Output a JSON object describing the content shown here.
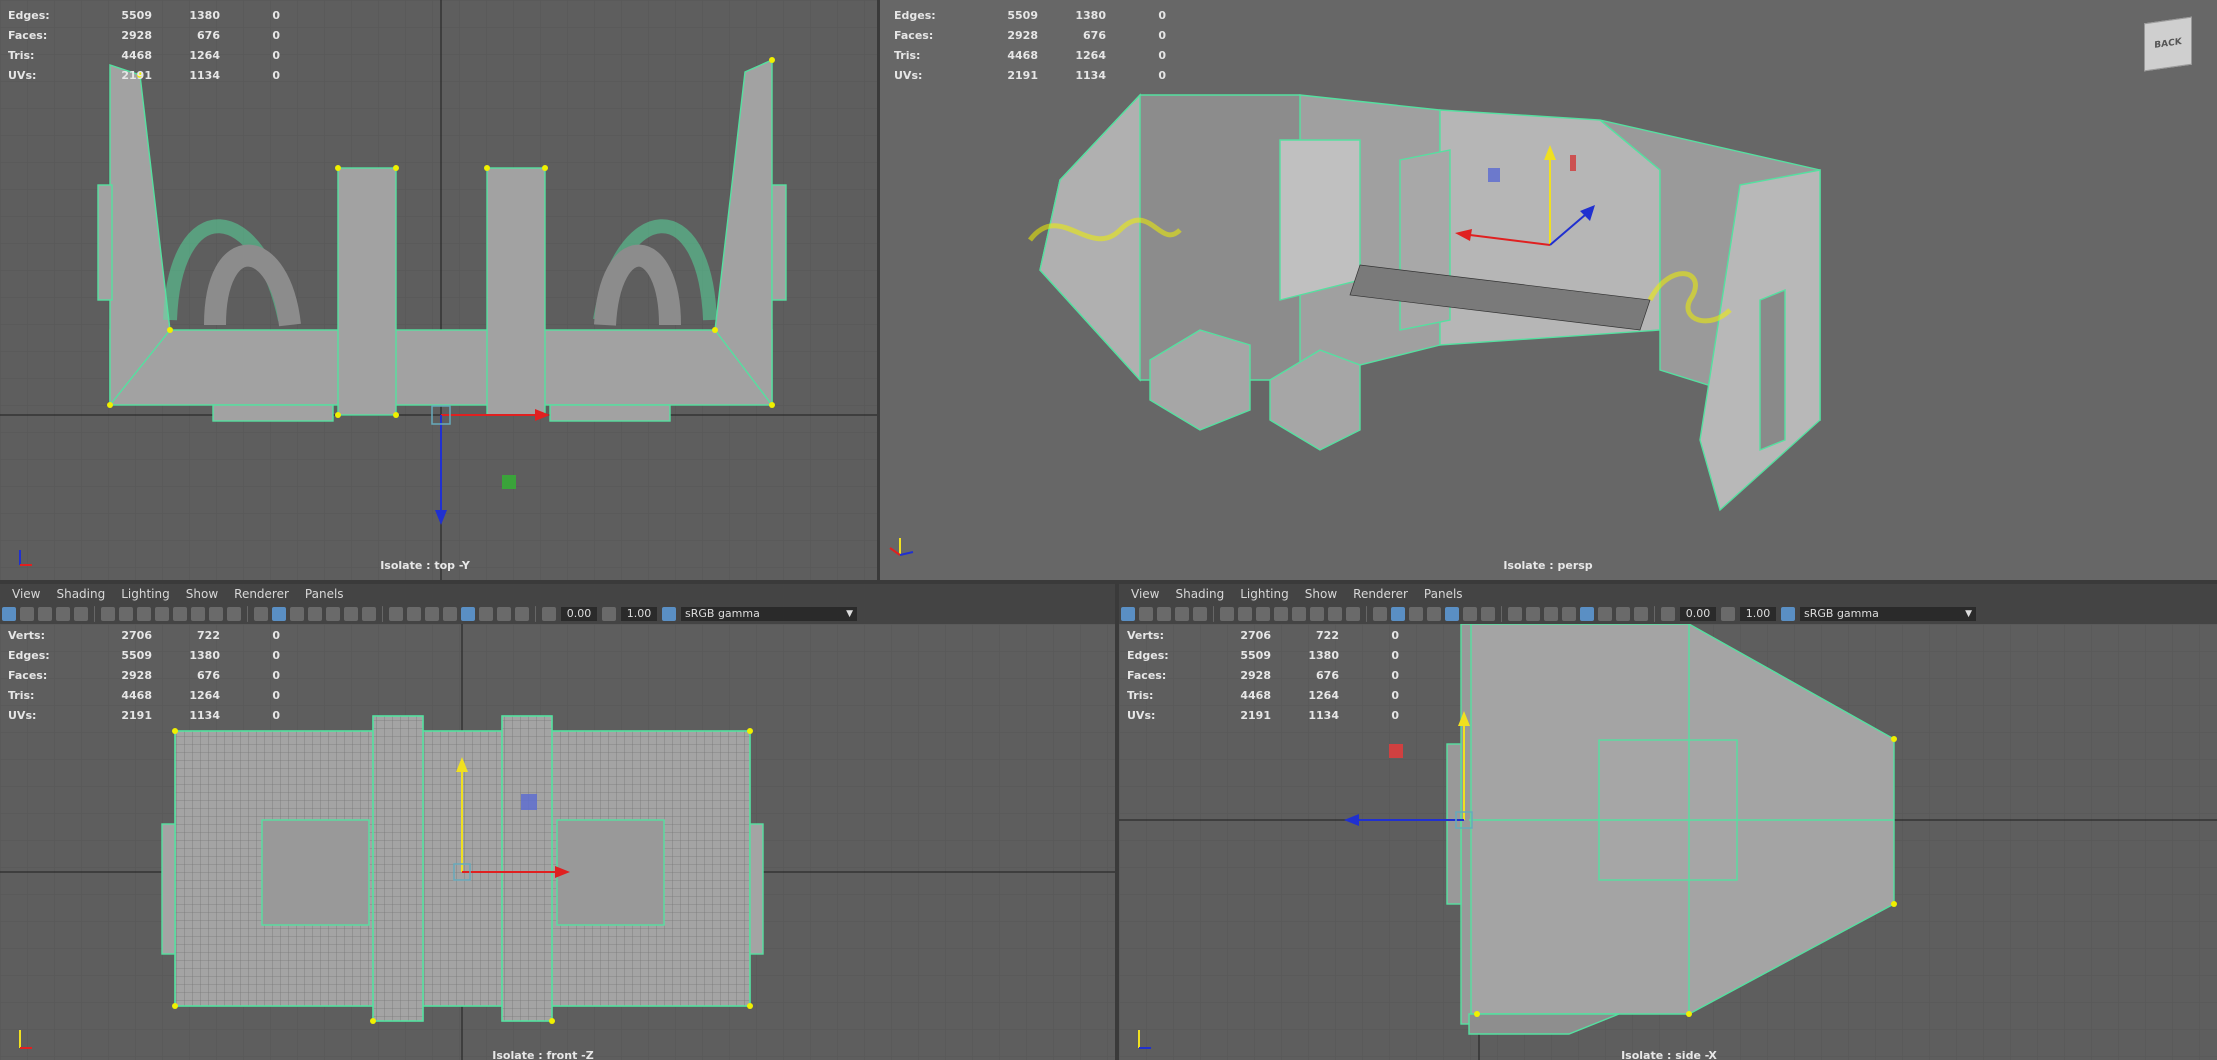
{
  "stats": {
    "rows": [
      {
        "label": "Verts:",
        "a": "2706",
        "b": "722",
        "c": "0"
      },
      {
        "label": "Edges:",
        "a": "5509",
        "b": "1380",
        "c": "0"
      },
      {
        "label": "Faces:",
        "a": "2928",
        "b": "676",
        "c": "0"
      },
      {
        "label": "Tris:",
        "a": "4468",
        "b": "1264",
        "c": "0"
      },
      {
        "label": "UVs:",
        "a": "2191",
        "b": "1134",
        "c": "0"
      }
    ]
  },
  "viewports": {
    "top": {
      "label": "Isolate : top -Y"
    },
    "persp": {
      "label": "Isolate : persp"
    },
    "front": {
      "label": "Isolate : front -Z"
    },
    "side": {
      "label": "Isolate : side -X"
    }
  },
  "menu": {
    "items": [
      "View",
      "Shading",
      "Lighting",
      "Show",
      "Renderer",
      "Panels"
    ]
  },
  "toolbar": {
    "exposure": "0.00",
    "gamma_value": "1.00",
    "color_space": "sRGB gamma"
  },
  "viewcube": {
    "face": "BACK"
  },
  "colors": {
    "viewport_bg": "#5e5e5e",
    "grid": "#555555",
    "wire": "#55e0a0",
    "mesh": "#9a9a9a",
    "vertex": "#f0f000",
    "axis_x": "#e02020",
    "axis_y": "#f0e020",
    "axis_z": "#2030d0"
  }
}
